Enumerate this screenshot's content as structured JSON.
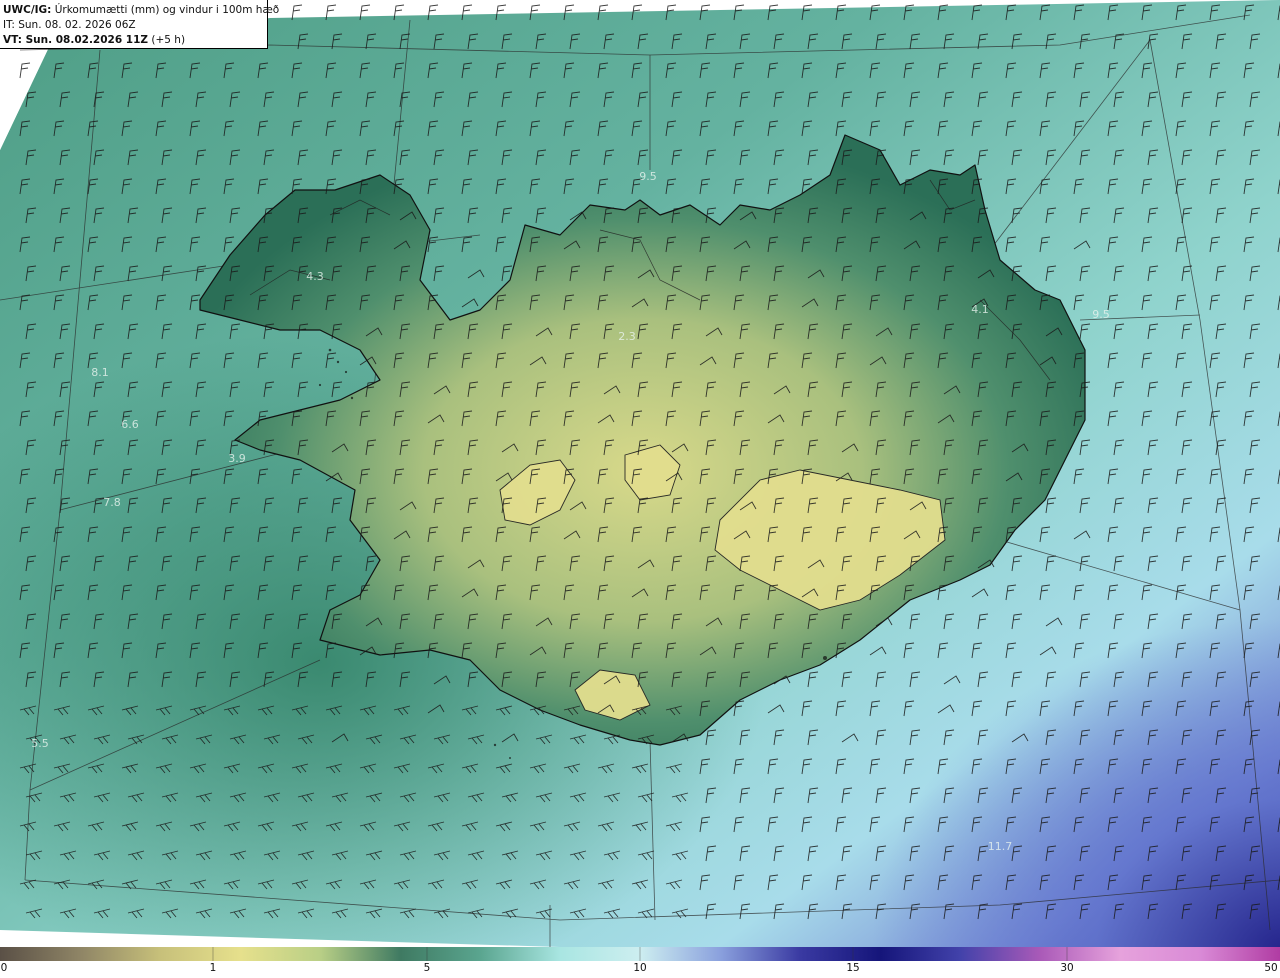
{
  "header": {
    "model": "UWC/IG:",
    "title": "Úrkomumætti (mm) og vindur i 100m hæð",
    "issue_time": "IT: Sun. 08. 02. 2026 06Z",
    "valid_prefix": "VT: Sun. 08.02.2026 11Z",
    "valid_suffix": "(+5 h)"
  },
  "colorbar": {
    "ticks": [
      "0",
      "1",
      "5",
      "10",
      "15",
      "30",
      "50"
    ],
    "stops": [
      "#5a5046",
      "#8f8566",
      "#c7c07a",
      "#e6e08c",
      "#b9cf86",
      "#3f7a62",
      "#5aa58f",
      "#a9e6e2",
      "#cdeef0",
      "#8aa0dd",
      "#3a3aa2",
      "#15157a",
      "#4242aa",
      "#aa5ab8",
      "#e6a2dc",
      "#d98ad6",
      "#b03ca3"
    ]
  },
  "colors": {
    "ocean": "#6fbfaf",
    "land_wet": "#2e7a5e",
    "land_dry": "#dbd88a",
    "high_precip": "#3a3aa2",
    "coastline": "#111111",
    "grid": "#2a2a2a",
    "wind_barb": "#1a1a1a"
  },
  "map_labels": [
    {
      "text": "4.3"
    },
    {
      "text": "2.3"
    },
    {
      "text": "4.1"
    },
    {
      "text": "9.5"
    },
    {
      "text": "8.1"
    },
    {
      "text": "6.6"
    },
    {
      "text": "3.9"
    },
    {
      "text": "7.8"
    },
    {
      "text": "5.5"
    },
    {
      "text": "11.7"
    },
    {
      "text": "9.5"
    }
  ],
  "icons": [
    "wind-barb-icon"
  ]
}
